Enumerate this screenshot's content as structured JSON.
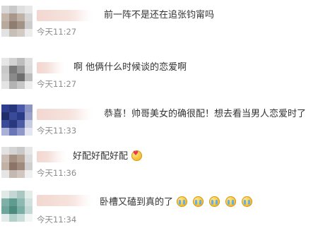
{
  "comments": [
    {
      "text": "前一阵不是还在追张钧甯吗",
      "time": "今天11:27",
      "emoji_count": 0,
      "avatar_colors": [
        "#d8d8d8",
        "#c9c9c9",
        "#dfdfdf",
        "#e8e8e8",
        "#c4b7aa",
        "#a8978a",
        "#bfb2a6",
        "#d6d6d6",
        "#b7aa9c",
        "#8e7d70",
        "#a39386",
        "#cccccc",
        "#e2e2e2",
        "#c8bfb6",
        "#d3cbc3",
        "#ececec"
      ]
    },
    {
      "text": "啊 他俩什么时候谈的恋爱啊",
      "time": "今天11:27",
      "emoji_count": 0,
      "avatar_colors": [
        "#e6e6e6",
        "#d2d2d2",
        "#bdbdbd",
        "#dedede",
        "#c8c8c8",
        "#7a7a7a",
        "#9b9b9b",
        "#d9d9d9",
        "#cfcfcf",
        "#8a8a8a",
        "#6e6e6e",
        "#bcbcbc",
        "#e4e4e4",
        "#b3b3b3",
        "#c7c7c7",
        "#eeeeee"
      ]
    },
    {
      "text": "恭喜！帅哥美女的确很配！想去看当男人恋爱时了",
      "time": "今天11:33",
      "emoji_count": 0,
      "avatar_colors": [
        "#2f3f8f",
        "#27357a",
        "#4a5aa8",
        "#8c94c4",
        "#1f2d6b",
        "#3a4a9a",
        "#2b3a86",
        "#9aa2cc",
        "#394a97",
        "#2a387f",
        "#4b5ba6",
        "#c7cbe2",
        "#aab1d6",
        "#6a77b6",
        "#8f98c8",
        "#e3e5f1"
      ]
    },
    {
      "text": "好配好配好配",
      "time": "今天11:36",
      "emoji_count": 1,
      "avatar_colors": [
        "#e2e2e2",
        "#d4d4d4",
        "#c9c9c9",
        "#e6e6e6",
        "#cbbdb3",
        "#a48f83",
        "#b6a397",
        "#dbdbdb",
        "#c2b2a6",
        "#8c7568",
        "#9f8a7d",
        "#cfcfcf",
        "#e5e5e5",
        "#c4b8b0",
        "#d1c7c0",
        "#f0f0f0"
      ]
    },
    {
      "text": "卧槽又磕到真的了",
      "time": "今天11:34",
      "emoji_count": 5,
      "avatar_colors": [
        "#dfe9e7",
        "#c3d8d4",
        "#a9c8c2",
        "#e4ecea",
        "#7fb0a8",
        "#5e9c92",
        "#8cbab3",
        "#d0e0dd",
        "#6ea59c",
        "#4d8b81",
        "#7aaea6",
        "#c4d9d5",
        "#e2ebe9",
        "#b2cfca",
        "#c9ddd9",
        "#f2f6f5"
      ]
    }
  ]
}
